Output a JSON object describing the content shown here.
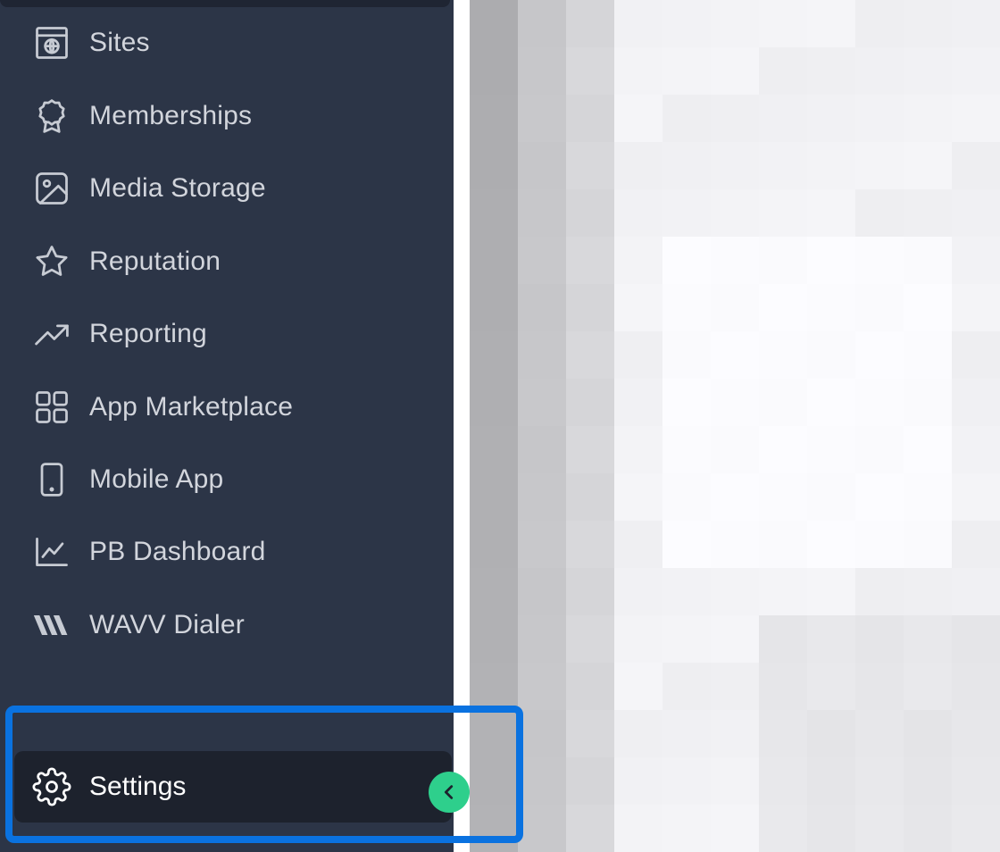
{
  "sidebar": {
    "items": [
      {
        "label": "Sites",
        "icon": "globe-window-icon"
      },
      {
        "label": "Memberships",
        "icon": "award-badge-icon"
      },
      {
        "label": "Media Storage",
        "icon": "image-icon"
      },
      {
        "label": "Reputation",
        "icon": "star-icon"
      },
      {
        "label": "Reporting",
        "icon": "trending-up-icon"
      },
      {
        "label": "App Marketplace",
        "icon": "grid-apps-icon"
      },
      {
        "label": "Mobile App",
        "icon": "mobile-phone-icon"
      },
      {
        "label": "PB Dashboard",
        "icon": "line-chart-icon"
      },
      {
        "label": "WAVV Dialer",
        "icon": "wavv-logo-icon"
      }
    ],
    "settings": {
      "label": "Settings",
      "icon": "gear-icon"
    },
    "collapse": {
      "icon": "chevron-left-icon"
    }
  },
  "colors": {
    "sidebar_bg": "#2c3547",
    "active_bg": "#1d222d",
    "accent_green": "#2ecf8c",
    "highlight_blue": "#0a72e0"
  }
}
